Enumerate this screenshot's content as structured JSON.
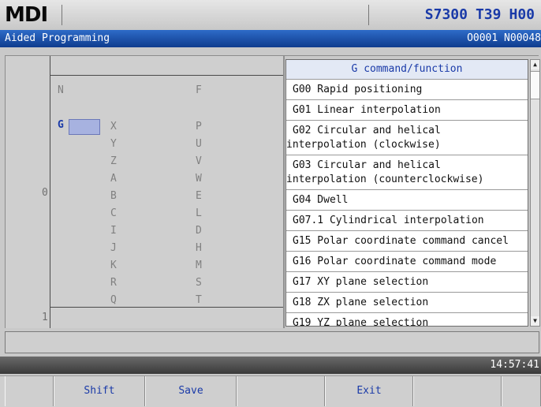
{
  "header": {
    "mode": "MDI",
    "spindle": "S7300",
    "tool": "T39",
    "h_offset": "H00"
  },
  "titlebar": {
    "title": "Aided Programming",
    "program": "O0001 N00048"
  },
  "editor": {
    "row_numbers": [
      "0",
      "1"
    ],
    "addresses": {
      "col1": [
        "N",
        "G",
        "",
        "",
        "",
        "",
        "",
        "",
        "",
        "",
        "",
        ""
      ],
      "col2": [
        "",
        "X",
        "Y",
        "Z",
        "A",
        "B",
        "C",
        "I",
        "J",
        "K",
        "R",
        "Q"
      ],
      "col3": [
        "F",
        "P",
        "U",
        "V",
        "W",
        "E",
        "L",
        "D",
        "H",
        "M",
        "S",
        "T"
      ]
    },
    "active_address": "G"
  },
  "g_list": {
    "header": "G command/function",
    "items": [
      {
        "line1": "G00 Rapid positioning"
      },
      {
        "line1": "G01 Linear interpolation"
      },
      {
        "line1": "G02 Circular and helical",
        "line2": "interpolation (clockwise)"
      },
      {
        "line1": "G03 Circular and helical",
        "line2": "interpolation (counterclockwise)"
      },
      {
        "line1": "G04 Dwell"
      },
      {
        "line1": "G07.1 Cylindrical interpolation"
      },
      {
        "line1": "G15 Polar coordinate command cancel"
      },
      {
        "line1": "G16 Polar coordinate command mode"
      },
      {
        "line1": "G17 XY plane selection"
      },
      {
        "line1": "G18 ZX plane selection"
      },
      {
        "line1": "G19 YZ plane selection"
      }
    ]
  },
  "input_line": "",
  "clock": "14:57:41",
  "softkeys": [
    "",
    "Shift",
    "Save",
    "",
    "Exit",
    "",
    ""
  ],
  "colors": {
    "title_blue": "#1f55b0",
    "accent_text": "#1a3aa8",
    "field_highlight": "#a7b2e0"
  }
}
